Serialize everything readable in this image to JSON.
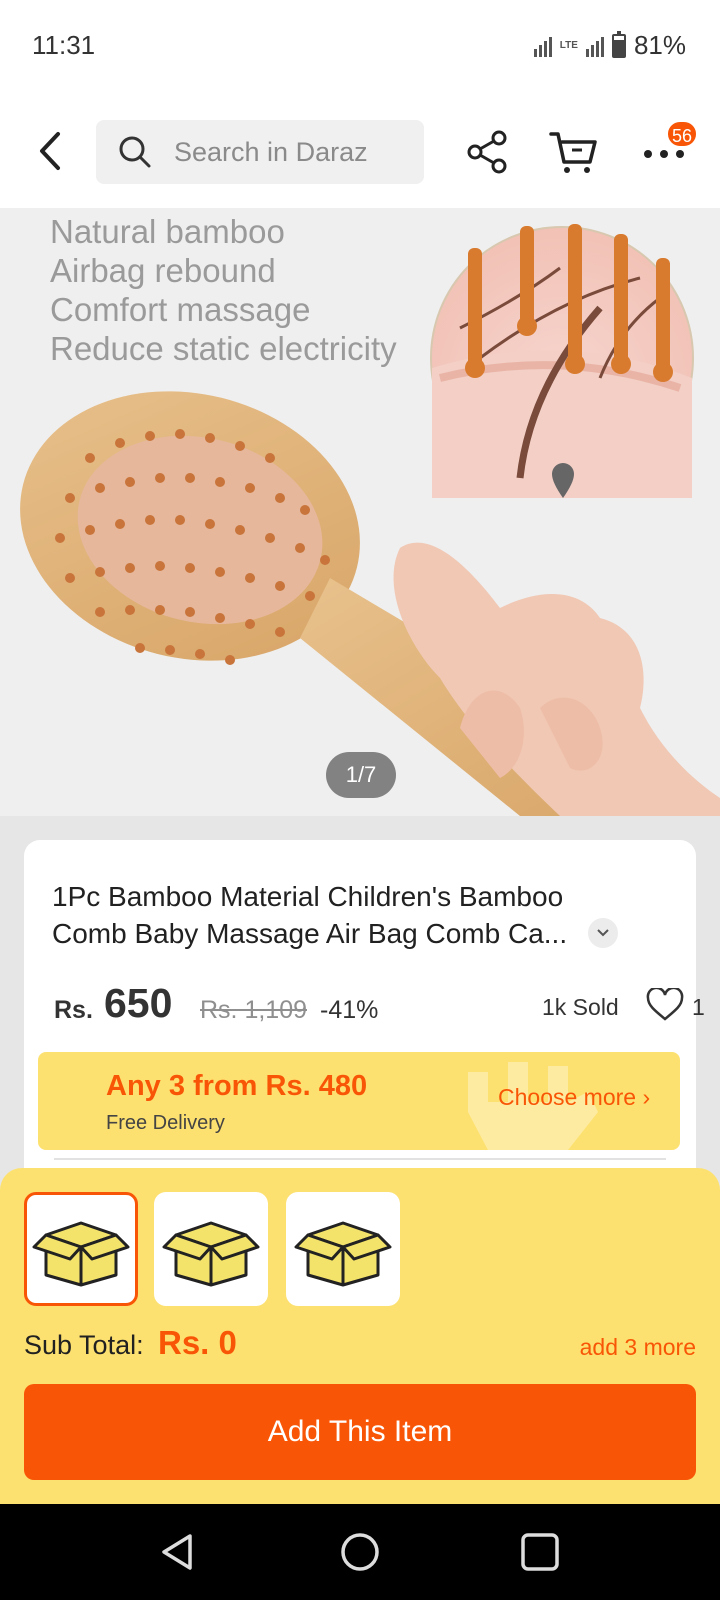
{
  "status_bar": {
    "time": "11:31",
    "network": "LTE",
    "battery": "81%"
  },
  "header": {
    "search_placeholder": "Search in Daraz",
    "cart_badge": "56",
    "icons": [
      "back-icon",
      "search-icon",
      "share-icon",
      "cart-icon",
      "more-icon"
    ]
  },
  "gallery": {
    "features": [
      "Natural bamboo",
      "Airbag rebound",
      "Comfort massage",
      "Reduce static electricity"
    ],
    "counter": "1/7"
  },
  "product": {
    "title": "1Pc Bamboo Material Children's Bamboo Comb Baby Massage Air Bag Comb Ca...",
    "currency": "Rs.",
    "price": "650",
    "original_price": "Rs. 1,109",
    "discount": "-41%",
    "sold": "1k Sold",
    "wishlist_count": "1"
  },
  "promo": {
    "title": "Any 3 from Rs. 480",
    "subtitle": "Free Delivery",
    "action": "Choose more"
  },
  "bundle": {
    "slots": 3,
    "selected_index": 0,
    "subtotal_label": "Sub Total:",
    "subtotal_value": "Rs. 0",
    "add_more": "add 3 more",
    "add_button": "Add This Item"
  },
  "colors": {
    "accent": "#f85606",
    "sheet": "#fde170",
    "box": "#f3e36b"
  }
}
